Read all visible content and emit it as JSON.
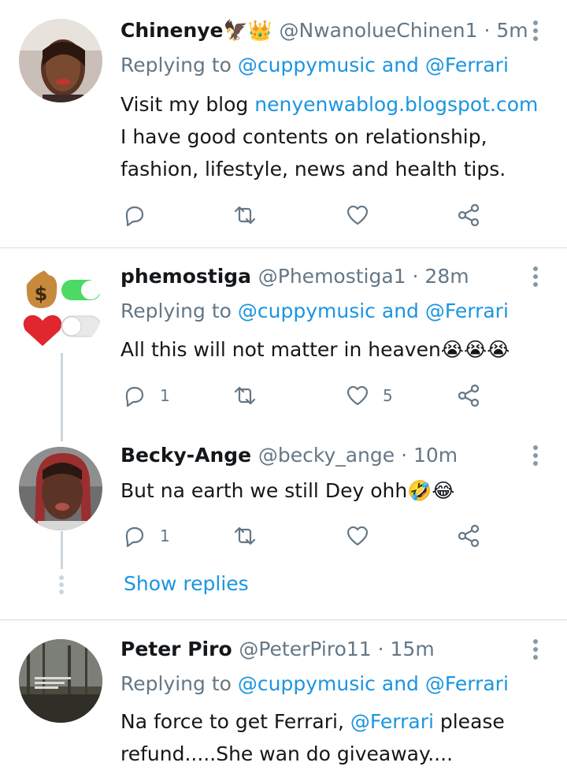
{
  "tweets": [
    {
      "name": "Chinenye🦅👑",
      "handle": "@NwanolueChinen1 · 5m",
      "replying_prefix": "Replying to ",
      "replying_to": "@cuppymusic and @Ferrari",
      "text_before": "Visit my blog ",
      "text_link": "nenyenwablog.blogspot.com",
      "text_after": " I have good contents on relationship, fashion, lifestyle, news and health tips.",
      "reply_count": "",
      "retweet_count": "",
      "like_count": ""
    },
    {
      "name": "phemostiga",
      "handle": "@Phemostiga1 · 28m",
      "replying_prefix": "Replying to ",
      "replying_to": "@cuppymusic and @Ferrari",
      "text": "All this will not matter in heaven😭😭😭",
      "reply_count": "1",
      "retweet_count": "",
      "like_count": "5"
    },
    {
      "name": "Becky-Ange",
      "handle": "@becky_ange · 10m",
      "text": "But na earth we still Dey ohh🤣😂",
      "reply_count": "1",
      "retweet_count": "",
      "like_count": ""
    },
    {
      "name": "Peter Piro",
      "handle": "@PeterPiro11 · 15m",
      "replying_prefix": "Replying to ",
      "replying_to": "@cuppymusic and @Ferrari",
      "text_line1_before": "Na force to get Ferrari, ",
      "text_line1_link": "@Ferrari",
      "text_line1_after": " please",
      "text_line2": "refund.....She wan do giveaway...."
    }
  ],
  "show_replies": "Show replies",
  "icons": {
    "reply": "reply-icon",
    "retweet": "retweet-icon",
    "like": "heart-icon",
    "share": "share-icon",
    "menu": "more-vertical-icon"
  },
  "colors": {
    "accent": "#1b95e0",
    "secondary_text": "#657786",
    "primary_text": "#14171a",
    "divider": "#d8dde1"
  }
}
